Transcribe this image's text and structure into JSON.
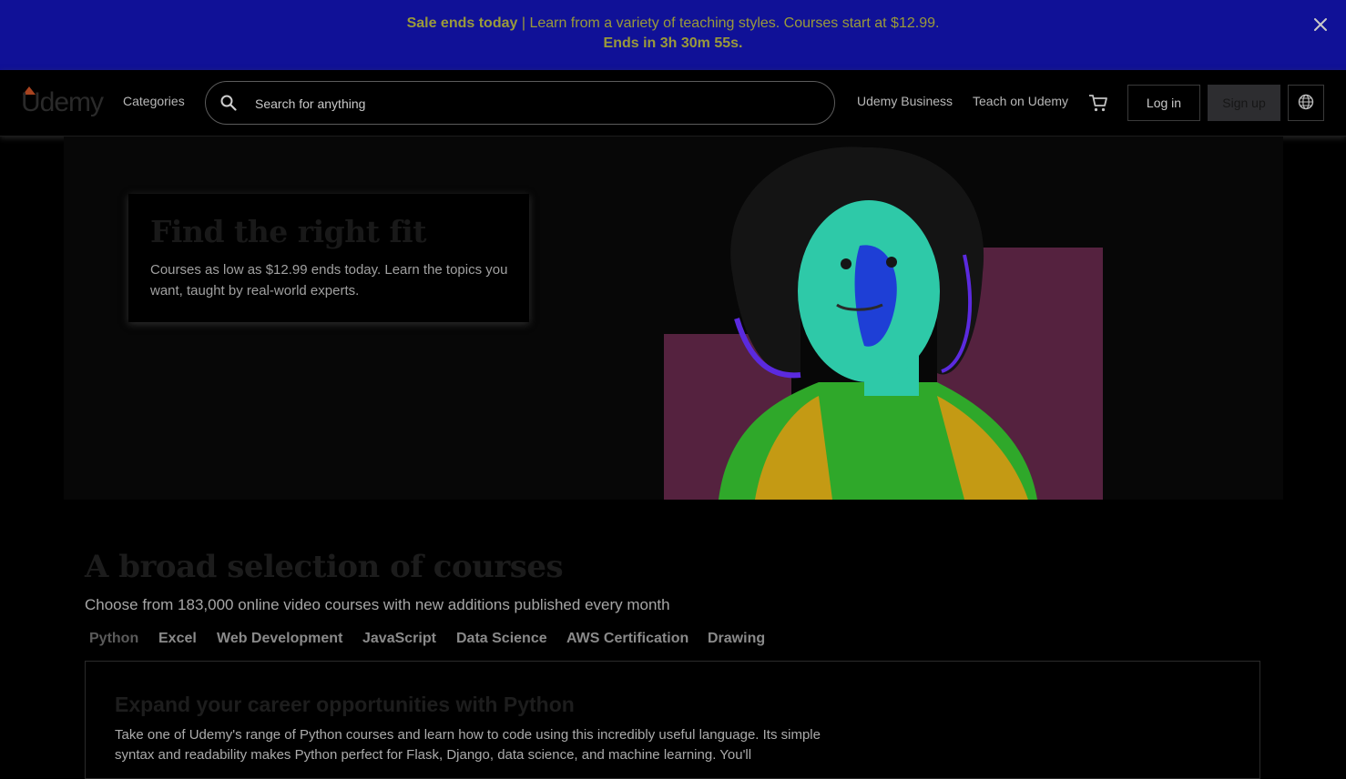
{
  "banner": {
    "sale_label": "Sale ends today",
    "message": " | Learn from a variety of teaching styles. Courses start at $12.99.",
    "countdown": "Ends in 3h 30m 55s.",
    "close_icon": "close-icon"
  },
  "header": {
    "logo_text": "Udemy",
    "categories_label": "Categories",
    "search": {
      "placeholder": "Search for anything",
      "icon": "search-icon"
    },
    "business_label": "Udemy Business",
    "teach_label": "Teach on Udemy",
    "cart_icon": "cart-icon",
    "login_label": "Log in",
    "signup_label": "Sign up",
    "language_icon": "globe-icon"
  },
  "hero": {
    "title": "Find the right fit",
    "text": "Courses as low as $12.99 ends today. Learn the topics you want, taught by real-world experts."
  },
  "section": {
    "title": "A broad selection of courses",
    "subtitle": "Choose from 183,000 online video courses with new additions published every month",
    "tabs": [
      {
        "label": "Python",
        "active": true
      },
      {
        "label": "Excel",
        "active": false
      },
      {
        "label": "Web Development",
        "active": false
      },
      {
        "label": "JavaScript",
        "active": false
      },
      {
        "label": "Data Science",
        "active": false
      },
      {
        "label": "AWS Certification",
        "active": false
      },
      {
        "label": "Drawing",
        "active": false
      }
    ],
    "panel": {
      "title": "Expand your career opportunities with Python",
      "text": "Take one of Udemy's range of Python courses and learn how to code using this incredibly useful language. Its simple syntax and readability makes Python perfect for Flask, Django, data science, and machine learning. You'll"
    }
  },
  "colors": {
    "banner_bg": "#101197",
    "banner_text": "#9a9a3a",
    "logo_accent": "#a435f0",
    "hero_block": "#55223f"
  }
}
